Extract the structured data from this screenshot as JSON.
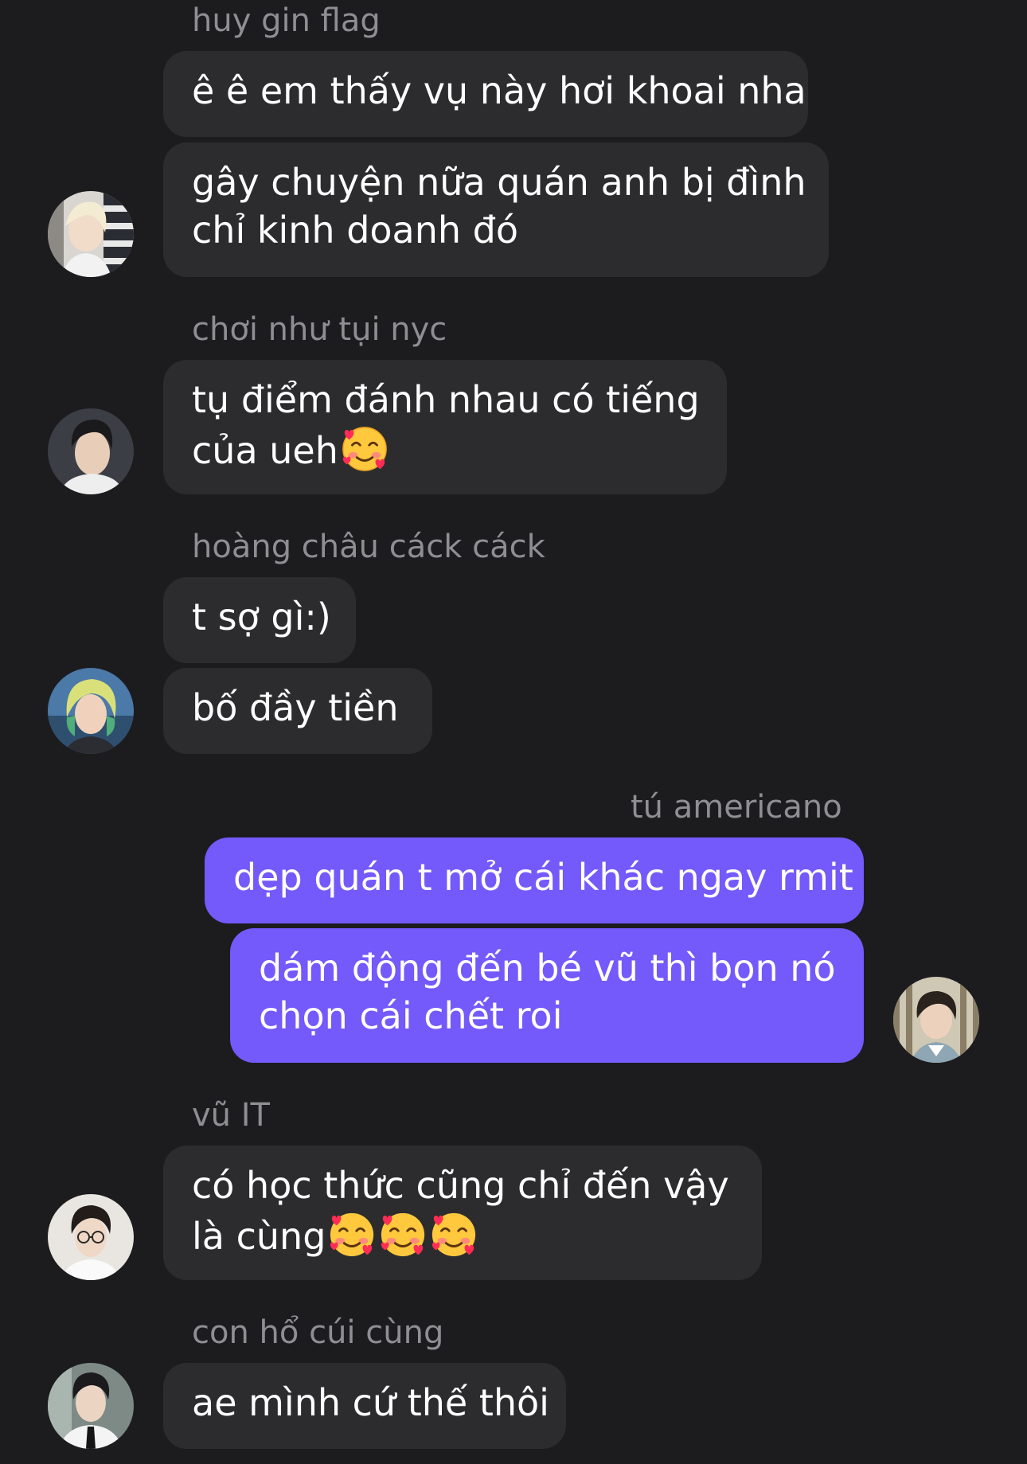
{
  "colors": {
    "background": "#1c1c1e",
    "incoming_bubble": "#2c2c2e",
    "outgoing_bubble": "#7459fb",
    "sender_name": "#8e8e93"
  },
  "groups": [
    {
      "sender": "huy gin flag",
      "direction": "incoming",
      "avatar_icon": "avatar-blonde-icon",
      "messages": [
        {
          "lines": [
            "ê ê em thấy vụ này hơi khoai nha"
          ]
        },
        {
          "lines": [
            "gây chuyện nữa quán anh bị đình",
            "chỉ kinh doanh đó"
          ]
        }
      ]
    },
    {
      "sender": "chơi như tụi nyc",
      "direction": "incoming",
      "avatar_icon": "avatar-darkhair-icon",
      "messages": [
        {
          "lines": [
            "tụ điểm đánh nhau có tiếng",
            "của ueh"
          ],
          "emoji": [
            "smiling-face-with-hearts-icon"
          ]
        }
      ]
    },
    {
      "sender": "hoàng châu cáck cáck",
      "direction": "incoming",
      "avatar_icon": "avatar-greenhair-icon",
      "messages": [
        {
          "lines": [
            "t sợ gì:)"
          ]
        },
        {
          "lines": [
            "bố đầy tiền"
          ]
        }
      ]
    },
    {
      "sender": "tú americano",
      "direction": "outgoing",
      "avatar_icon": "avatar-curtain-icon",
      "messages": [
        {
          "lines": [
            "dẹp quán t mở cái khác ngay rmit"
          ]
        },
        {
          "lines": [
            "dám động đến bé vũ thì bọn nó",
            "chọn cái chết roi"
          ]
        }
      ]
    },
    {
      "sender": "vũ IT",
      "direction": "incoming",
      "avatar_icon": "avatar-glasses-icon",
      "messages": [
        {
          "lines": [
            "có học thức cũng chỉ đến vậy",
            "là cùng"
          ],
          "emoji": [
            "smiling-face-with-hearts-icon",
            "smiling-face-with-hearts-icon",
            "smiling-face-with-hearts-icon"
          ]
        }
      ]
    },
    {
      "sender": "con hổ cúi cùng",
      "direction": "incoming",
      "avatar_icon": "avatar-suit-icon",
      "messages": [
        {
          "lines": [
            "ae mình cứ thế thôi"
          ]
        }
      ]
    }
  ]
}
